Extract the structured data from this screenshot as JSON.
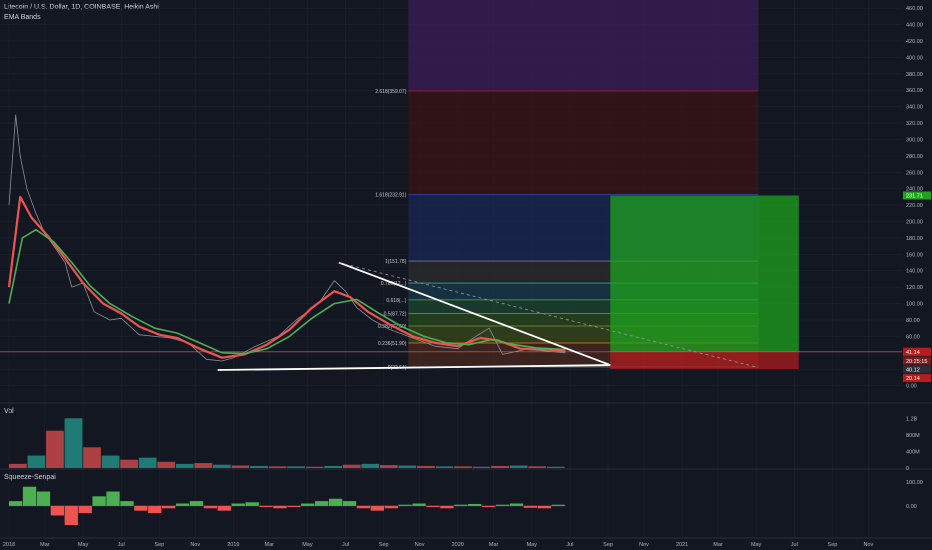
{
  "header": {
    "symbol_line": "Litecoin / U.S. Dollar, 1D, COINBASE, Heikin Ashi",
    "indicator": "EMA Bands"
  },
  "panes": {
    "volume_label": "Vol",
    "squeeze_label": "Squeeze-Senpai"
  },
  "colors": {
    "background": "#131722",
    "grid": "#1e222d",
    "axis_text": "#b2b5be",
    "ema_fast": "#4caf50",
    "ema_slow": "#ef5350",
    "price": "#8a8f9a",
    "trendline": "#ffffff",
    "target_zone": "#1fa31f",
    "stop_zone": "#b71c1c"
  },
  "chart_data": [
    {
      "type": "line",
      "title": "Litecoin / U.S. Dollar, 1D, COINBASE, Heikin Ashi",
      "ylim": [
        -20,
        470
      ],
      "y_ticks": [
        "460.00",
        "440.00",
        "420.00",
        "400.00",
        "380.00",
        "360.00",
        "340.00",
        "320.00",
        "300.00",
        "280.00",
        "260.00",
        "240.00",
        "220.00",
        "200.00",
        "180.00",
        "160.00",
        "140.00",
        "120.00",
        "100.00",
        "80.00",
        "60.00",
        "40.00",
        "20.00",
        "0.00"
      ],
      "x_ticks": [
        "2018",
        "Mar",
        "May",
        "Jul",
        "Sep",
        "Nov",
        "2019",
        "Mar",
        "May",
        "Jul",
        "Sep",
        "Nov",
        "2020",
        "Mar",
        "May",
        "Jul",
        "Sep",
        "Nov",
        "2021",
        "Mar",
        "May",
        "Jul",
        "Sep",
        "Nov"
      ],
      "series": [
        {
          "values": [
            [
              2018.0,
              220
            ],
            [
              2018.03,
              330
            ],
            [
              2018.05,
              280
            ],
            [
              2018.08,
              240
            ],
            [
              2018.12,
              210
            ],
            [
              2018.16,
              185
            ],
            [
              2018.2,
              170
            ],
            [
              2018.25,
              150
            ],
            [
              2018.28,
              120
            ],
            [
              2018.33,
              125
            ],
            [
              2018.38,
              90
            ],
            [
              2018.45,
              80
            ],
            [
              2018.5,
              82
            ],
            [
              2018.58,
              62
            ],
            [
              2018.65,
              60
            ],
            [
              2018.72,
              58
            ],
            [
              2018.8,
              52
            ],
            [
              2018.88,
              32
            ],
            [
              2018.95,
              30
            ],
            [
              2019.0,
              34
            ],
            [
              2019.1,
              48
            ],
            [
              2019.2,
              60
            ],
            [
              2019.28,
              80
            ],
            [
              2019.38,
              100
            ],
            [
              2019.45,
              128
            ],
            [
              2019.5,
              115
            ],
            [
              2019.55,
              95
            ],
            [
              2019.62,
              80
            ],
            [
              2019.7,
              68
            ],
            [
              2019.8,
              58
            ],
            [
              2019.9,
              48
            ],
            [
              2020.0,
              45
            ],
            [
              2020.08,
              60
            ],
            [
              2020.14,
              70
            ],
            [
              2020.2,
              38
            ],
            [
              2020.3,
              44
            ],
            [
              2020.4,
              42
            ],
            [
              2020.48,
              40
            ]
          ]
        },
        {
          "name": "EMA Bands",
          "values": [
            [
              2018.0,
              120
            ],
            [
              2018.05,
              230
            ],
            [
              2018.1,
              205
            ],
            [
              2018.18,
              180
            ],
            [
              2018.25,
              155
            ],
            [
              2018.33,
              125
            ],
            [
              2018.42,
              100
            ],
            [
              2018.5,
              88
            ],
            [
              2018.58,
              72
            ],
            [
              2018.67,
              62
            ],
            [
              2018.75,
              58
            ],
            [
              2018.85,
              45
            ],
            [
              2018.95,
              34
            ],
            [
              2019.05,
              38
            ],
            [
              2019.15,
              50
            ],
            [
              2019.25,
              68
            ],
            [
              2019.35,
              95
            ],
            [
              2019.45,
              115
            ],
            [
              2019.52,
              108
            ],
            [
              2019.6,
              90
            ],
            [
              2019.7,
              74
            ],
            [
              2019.8,
              60
            ],
            [
              2019.9,
              52
            ],
            [
              2020.0,
              48
            ],
            [
              2020.1,
              58
            ],
            [
              2020.18,
              55
            ],
            [
              2020.28,
              45
            ],
            [
              2020.4,
              44
            ],
            [
              2020.48,
              42
            ]
          ]
        },
        {
          "name": "EMA Bands",
          "values": [
            [
              2018.0,
              100
            ],
            [
              2018.06,
              180
            ],
            [
              2018.12,
              190
            ],
            [
              2018.2,
              175
            ],
            [
              2018.28,
              150
            ],
            [
              2018.36,
              122
            ],
            [
              2018.45,
              100
            ],
            [
              2018.55,
              84
            ],
            [
              2018.65,
              70
            ],
            [
              2018.75,
              64
            ],
            [
              2018.85,
              52
            ],
            [
              2018.95,
              40
            ],
            [
              2019.05,
              39
            ],
            [
              2019.15,
              45
            ],
            [
              2019.25,
              60
            ],
            [
              2019.35,
              82
            ],
            [
              2019.45,
              100
            ],
            [
              2019.55,
              105
            ],
            [
              2019.65,
              88
            ],
            [
              2019.75,
              72
            ],
            [
              2019.85,
              60
            ],
            [
              2019.95,
              52
            ],
            [
              2020.05,
              50
            ],
            [
              2020.15,
              56
            ],
            [
              2020.25,
              50
            ],
            [
              2020.35,
              46
            ],
            [
              2020.48,
              44
            ]
          ]
        }
      ],
      "fib_levels": [
        {
          "label": "2.618(359.07)",
          "value": 359.07
        },
        {
          "label": "1.618(232.91)",
          "value": 232.91
        },
        {
          "label": "1(151.78)",
          "value": 151.78
        },
        {
          "label": "0.786(12...)",
          "value": 125.0
        },
        {
          "label": "0.618(...)",
          "value": 104.5
        },
        {
          "label": "0.5(87.72)",
          "value": 87.72
        },
        {
          "label": "0.382(72.60)",
          "value": 72.6
        },
        {
          "label": "0.236(51.90)",
          "value": 51.9
        },
        {
          "label": "0(22.64)",
          "value": 22.64
        }
      ],
      "trendlines": [
        {
          "from": [
            2019.47,
            150
          ],
          "to": [
            2020.68,
            25
          ]
        },
        {
          "from": [
            2018.93,
            19
          ],
          "to": [
            2020.68,
            25
          ]
        }
      ],
      "position": {
        "entry": 41.17,
        "target": 231.71,
        "stop": 20.14
      },
      "price_labels": [
        {
          "text": "231.71",
          "value": 231.71,
          "color": "#1fa31f"
        },
        {
          "text": "41.17",
          "value": 41.17,
          "color": "#b71c1c"
        },
        {
          "text": "41.14",
          "value": 41.14,
          "color": "#b71c1c"
        },
        {
          "text": "20:25:15",
          "value": 30.5,
          "color": "#7a1a1a"
        },
        {
          "text": "40.12",
          "value": 19.8,
          "color": "#2a2e39"
        },
        {
          "text": "20.14",
          "value": 9.2,
          "color": "#b71c1c"
        }
      ]
    },
    {
      "type": "bar",
      "title": "Vol",
      "y_ticks": [
        "1.2B",
        "800M",
        "400M",
        "0"
      ],
      "ylim": [
        0,
        1.4
      ],
      "values": [
        0.1,
        0.3,
        0.9,
        1.2,
        0.5,
        0.3,
        0.2,
        0.25,
        0.15,
        0.1,
        0.12,
        0.08,
        0.06,
        0.05,
        0.04,
        0.04,
        0.03,
        0.05,
        0.08,
        0.1,
        0.07,
        0.06,
        0.05,
        0.04,
        0.04,
        0.03,
        0.05,
        0.06,
        0.04,
        0.03
      ]
    },
    {
      "type": "bar",
      "title": "Squeeze-Senpai",
      "y_ticks": [
        "100.00",
        "0.00"
      ],
      "ylim": [
        -130,
        150
      ],
      "values": [
        20,
        80,
        60,
        -40,
        -80,
        -30,
        40,
        60,
        20,
        -20,
        -30,
        -10,
        10,
        20,
        -10,
        -20,
        10,
        15,
        -5,
        -10,
        -5,
        10,
        20,
        30,
        20,
        -10,
        -20,
        -10,
        5,
        10,
        -5,
        -10,
        5,
        8,
        -5,
        5,
        10,
        -8,
        -10,
        5
      ]
    }
  ]
}
